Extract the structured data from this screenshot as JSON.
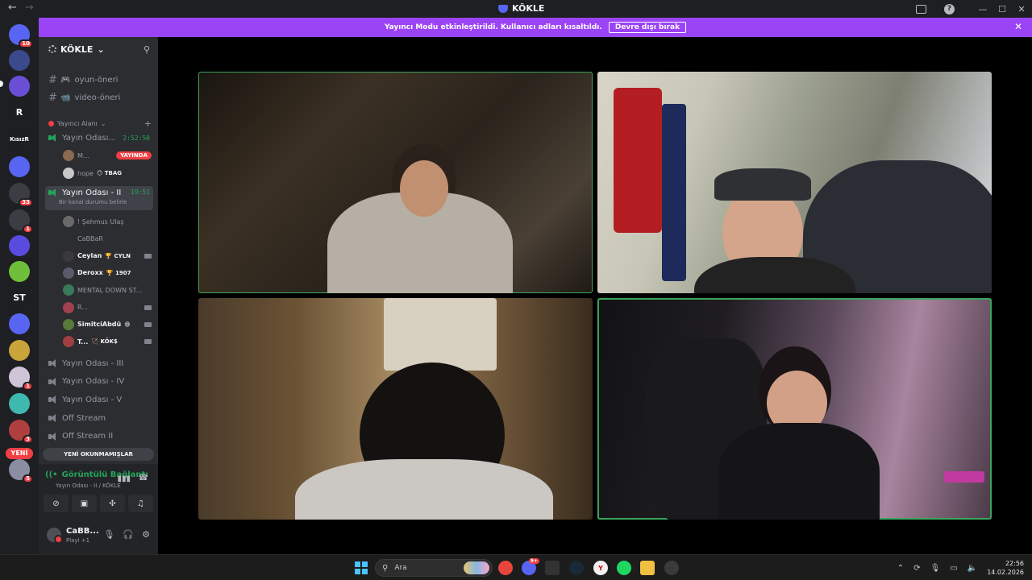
{
  "titlebar": {
    "title": "KÖKLE",
    "back": "←",
    "forward": "→",
    "help": "?",
    "minimize": "—",
    "maximize": "☐",
    "close": "✕"
  },
  "banner": {
    "text": "Yayıncı Modu etkinleştirildi. Kullanıcı adları kısaltıldı.",
    "button": "Devre dışı bırak",
    "close": "✕"
  },
  "rail": {
    "servers": [
      {
        "label": "",
        "badge": "10",
        "color": "#5865f2"
      },
      {
        "label": "",
        "badge": "",
        "color": "#3a4a8a"
      },
      {
        "label": "",
        "badge": "",
        "color": "#6a4fd6"
      },
      {
        "label": "R",
        "badge": "",
        "color": "#1e1f22"
      },
      {
        "label": "KısızR",
        "badge": "",
        "color": "#1e1f22"
      },
      {
        "label": "",
        "badge": "",
        "color": "#5865f2"
      },
      {
        "label": "",
        "badge": "33",
        "color": "#3c3d44"
      },
      {
        "label": "",
        "badge": "1",
        "color": "#3c3d44"
      },
      {
        "label": "",
        "badge": "",
        "color": "#5a4be0"
      },
      {
        "label": "",
        "badge": "",
        "color": "#6fbf3a"
      },
      {
        "label": "ST",
        "badge": "",
        "color": "#1e1f22"
      },
      {
        "label": "",
        "badge": "",
        "color": "#5865f2"
      },
      {
        "label": "",
        "badge": "",
        "color": "#c8a43a"
      },
      {
        "label": "",
        "badge": "1",
        "color": "#d0c4d8"
      },
      {
        "label": "",
        "badge": "",
        "color": "#3fb8b0"
      },
      {
        "label": "",
        "badge": "3",
        "color": "#b04040"
      }
    ],
    "new_label": "YENİ",
    "new_badge": "5"
  },
  "sidebar": {
    "server_name": "KÖKLE",
    "channels_top": [
      {
        "name": "oyun-öneri",
        "emoji": "🎮"
      },
      {
        "name": "video-öneri",
        "emoji": "📹"
      }
    ],
    "category": "Yayıncı Alanı",
    "voice1": {
      "name": "Yayın Odası...",
      "timer": "2:52:50"
    },
    "voice1_users": [
      {
        "name": "M...",
        "badge": "YAYINDA",
        "color": "#8a6a50"
      },
      {
        "name": "hope",
        "tag": "😶 TBAG",
        "color": "#c8c8c8"
      }
    ],
    "voice2": {
      "name": "Yayın Odası - II",
      "timer": "19:51",
      "status": "Bir kanal durumu belirle"
    },
    "voice2_users": [
      {
        "name": "! Şehmus Ulaş",
        "tag": "",
        "color": "#6a6a6a",
        "cam": false
      },
      {
        "name": "CaBBaR",
        "tag": "",
        "color": "#2b2d31",
        "cam": false
      },
      {
        "name": "Ceylan",
        "tag": "🏆 CYLN",
        "color": "#3a3a3a",
        "cam": true
      },
      {
        "name": "Deroxx",
        "tag": "🏆 1907",
        "color": "#5a5a6a",
        "cam": false
      },
      {
        "name": "MENTAL DOWN ST...",
        "tag": "",
        "color": "#3a7a5a",
        "cam": false
      },
      {
        "name": "R...",
        "tag": "",
        "color": "#a04050",
        "cam": true
      },
      {
        "name": "SimitciAbdü",
        "tag": "😄",
        "color": "#5a7a3a",
        "cam": true
      },
      {
        "name": "T...",
        "tag": "🏹 KÖK$",
        "color": "#a04040",
        "cam": true
      }
    ],
    "other_channels": [
      "Yayın Odası - III",
      "Yayın Odası - IV",
      "Yayın Odası - V",
      "Off Stream",
      "Off Stream II"
    ],
    "unread_button": "YENİ OKUNMAMIŞLAR"
  },
  "voice_panel": {
    "status": "Görüntülü Bağlantı",
    "channel": "Yayın Odası - II / KÖKLE",
    "user_name": "CaBB...",
    "user_status": "Playl +1"
  },
  "taskbar": {
    "search_placeholder": "Ara",
    "discord_badge": "9+",
    "time": "22:56",
    "date": "14.02.2026"
  }
}
